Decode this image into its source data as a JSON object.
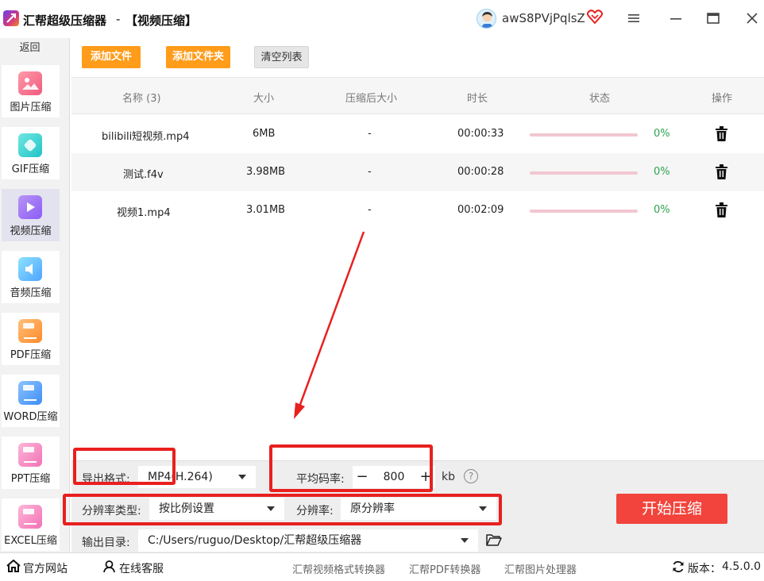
{
  "titlebar": {
    "app_name": "汇帮超级压缩器",
    "separator": "-",
    "page_title": "【视频压缩】",
    "username": "awS8PVjPqlsZ"
  },
  "sidebar": {
    "back_label": "返回",
    "items": [
      {
        "label": "图片压缩",
        "icon": "image-icon",
        "color": "#f05a7e"
      },
      {
        "label": "GIF压缩",
        "icon": "gif-icon",
        "color": "#22c3c9"
      },
      {
        "label": "视频压缩",
        "icon": "video-play-icon",
        "color": "#8b5cf6"
      },
      {
        "label": "音频压缩",
        "icon": "audio-icon",
        "color": "#4fa3ff"
      },
      {
        "label": "PDF压缩",
        "icon": "pdf-file-icon",
        "color": "#ff8a2a"
      },
      {
        "label": "WORD压缩",
        "icon": "word-file-icon",
        "color": "#3d8ef5"
      },
      {
        "label": "PPT压缩",
        "icon": "ppt-file-icon",
        "color": "#f472b6"
      },
      {
        "label": "EXCEL压缩",
        "icon": "excel-file-icon",
        "color": "#f472b6"
      }
    ]
  },
  "toolbar": {
    "add_file": "添加文件",
    "add_folder": "添加文件夹",
    "clear_list": "清空列表"
  },
  "table": {
    "headers": [
      "名称 (3)",
      "大小",
      "压缩后大小",
      "时长",
      "状态",
      "操作"
    ],
    "rows": [
      {
        "name": "bilibili短视频.mp4",
        "size": "6MB",
        "compressed": "-",
        "duration": "00:00:33",
        "progress": 0,
        "percent": "0%"
      },
      {
        "name": "测试.f4v",
        "size": "3.98MB",
        "compressed": "-",
        "duration": "00:00:28",
        "progress": 0,
        "percent": "0%"
      },
      {
        "name": "视频1.mp4",
        "size": "3.01MB",
        "compressed": "-",
        "duration": "00:02:09",
        "progress": 0,
        "percent": "0%"
      }
    ]
  },
  "settings": {
    "format_label": "导出格式:",
    "format_value": "MP4(H.264)",
    "bitrate_label": "平均码率:",
    "bitrate_value": "800",
    "bitrate_minus": "−",
    "bitrate_plus": "+",
    "bitrate_unit": "kb",
    "help": "?",
    "res_type_label": "分辨率类型:",
    "res_type_value": "按比例设置",
    "res_label": "分辨率:",
    "res_value": "原分辨率",
    "output_label": "输出目录:",
    "output_value": "C:/Users/ruguo/Desktop/汇帮超级压缩器",
    "start_button": "开始压缩"
  },
  "statusbar": {
    "website": "官方网站",
    "support": "在线客服",
    "links": [
      "汇帮视频格式转换器",
      "汇帮PDF转换器",
      "汇帮图片处理器"
    ],
    "version_label": "版本：",
    "version_value": "4.5.0.0"
  },
  "colors": {
    "accent_orange": "#ff9c1a",
    "start_red": "#f2443c",
    "progress_pink": "#f2c6d2",
    "percent_green": "#2da44e",
    "annotation_red": "#e8201f"
  }
}
